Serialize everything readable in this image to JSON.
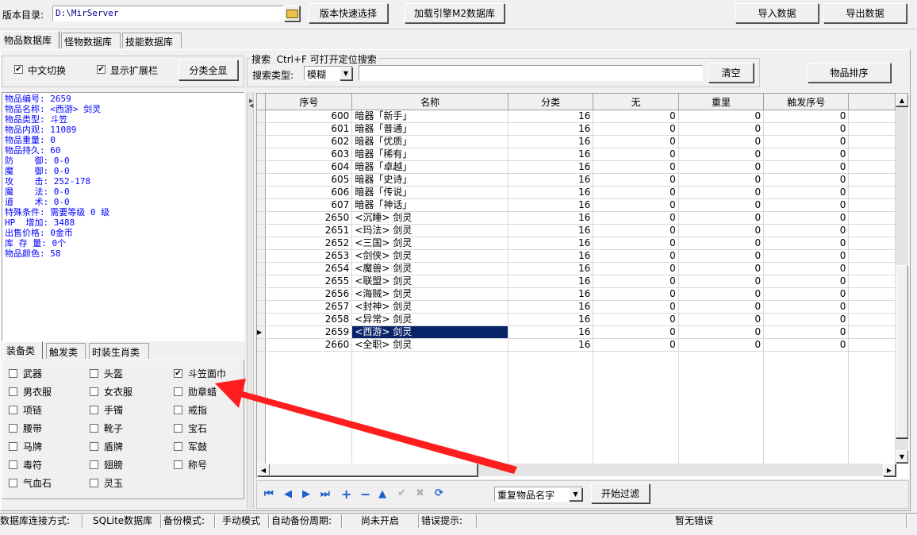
{
  "toolbar": {
    "version_dir_label": "版本目录:",
    "version_dir_value": "D:\\MirServer",
    "quick_select": "版本快速选择",
    "load_m2": "加载引擎M2数据库",
    "import": "导入数据",
    "export": "导出数据"
  },
  "tabs": [
    "物品数据库",
    "怪物数据库",
    "技能数据库"
  ],
  "options": {
    "chinese_switch": "中文切换",
    "show_ext": "显示扩展栏",
    "show_all": "分类全显"
  },
  "search": {
    "group_title": "搜索  Ctrl+F 可打开定位搜索",
    "type_label": "搜索类型:",
    "type_value": "模糊",
    "input_value": "",
    "clear": "清空",
    "sort": "物品排序"
  },
  "info": [
    "物品编号: 2659",
    "物品名称: <西游> 剑灵",
    "物品类型: 斗笠",
    "物品内观: 11089",
    "物品重量: 0",
    "物品持久: 60",
    "防    御: 0-0",
    "魔    御: 0-0",
    "攻    击: 252-178",
    "魔    法: 0-0",
    "道    术: 0-0",
    "特殊条件: 需要等级 0 级",
    "HP  增加: 3488",
    "出售价格: 0金币",
    "库 存 量: 0个",
    "物品颜色: 58"
  ],
  "cat_tabs": [
    "装备类",
    "触发类",
    "时装生肖类"
  ],
  "categories": [
    {
      "label": "武器",
      "checked": false
    },
    {
      "label": "头盔",
      "checked": false
    },
    {
      "label": "斗笠面巾",
      "checked": true
    },
    {
      "label": "男衣服",
      "checked": false
    },
    {
      "label": "女衣服",
      "checked": false
    },
    {
      "label": "勋章蜡",
      "checked": false
    },
    {
      "label": "项链",
      "checked": false
    },
    {
      "label": "手镯",
      "checked": false
    },
    {
      "label": "戒指",
      "checked": false
    },
    {
      "label": "腰带",
      "checked": false
    },
    {
      "label": "靴子",
      "checked": false
    },
    {
      "label": "宝石",
      "checked": false
    },
    {
      "label": "马牌",
      "checked": false
    },
    {
      "label": "盾牌",
      "checked": false
    },
    {
      "label": "军鼓",
      "checked": false
    },
    {
      "label": "毒符",
      "checked": false
    },
    {
      "label": "翅膀",
      "checked": false
    },
    {
      "label": "称号",
      "checked": false
    },
    {
      "label": "气血石",
      "checked": false
    },
    {
      "label": "灵玉",
      "checked": false
    }
  ],
  "grid": {
    "columns": [
      "序号",
      "名称",
      "分类",
      "无",
      "重里",
      "触发序号"
    ],
    "rows": [
      [
        "600",
        "暗器「新手」",
        "16",
        "0",
        "0",
        "0"
      ],
      [
        "601",
        "暗器「普通」",
        "16",
        "0",
        "0",
        "0"
      ],
      [
        "602",
        "暗器「优质」",
        "16",
        "0",
        "0",
        "0"
      ],
      [
        "603",
        "暗器「稀有」",
        "16",
        "0",
        "0",
        "0"
      ],
      [
        "604",
        "暗器「卓越」",
        "16",
        "0",
        "0",
        "0"
      ],
      [
        "605",
        "暗器「史诗」",
        "16",
        "0",
        "0",
        "0"
      ],
      [
        "606",
        "暗器「传说」",
        "16",
        "0",
        "0",
        "0"
      ],
      [
        "607",
        "暗器「神话」",
        "16",
        "0",
        "0",
        "0"
      ],
      [
        "2650",
        "<沉睡> 剑灵",
        "16",
        "0",
        "0",
        "0"
      ],
      [
        "2651",
        "<玛法> 剑灵",
        "16",
        "0",
        "0",
        "0"
      ],
      [
        "2652",
        "<三国> 剑灵",
        "16",
        "0",
        "0",
        "0"
      ],
      [
        "2653",
        "<剑侠> 剑灵",
        "16",
        "0",
        "0",
        "0"
      ],
      [
        "2654",
        "<魔兽> 剑灵",
        "16",
        "0",
        "0",
        "0"
      ],
      [
        "2655",
        "<联盟> 剑灵",
        "16",
        "0",
        "0",
        "0"
      ],
      [
        "2656",
        "<海贼> 剑灵",
        "16",
        "0",
        "0",
        "0"
      ],
      [
        "2657",
        "<封神> 剑灵",
        "16",
        "0",
        "0",
        "0"
      ],
      [
        "2658",
        "<异常> 剑灵",
        "16",
        "0",
        "0",
        "0"
      ],
      [
        "2659",
        "<西游> 剑灵",
        "16",
        "0",
        "0",
        "0"
      ],
      [
        "2660",
        "<全职> 剑灵",
        "16",
        "0",
        "0",
        "0"
      ]
    ],
    "selected_index": 17
  },
  "filter": {
    "select_value": "重复物品名字",
    "start": "开始过滤"
  },
  "status": {
    "conn_label": "数据库连接方式:",
    "conn_value": "SQLite数据库",
    "backup_label": "备份模式:",
    "backup_value": "手动模式",
    "auto_label": "自动备份周期:",
    "auto_value": "尚未开启",
    "err_label": "错误提示:",
    "err_value": "暂无错误"
  }
}
